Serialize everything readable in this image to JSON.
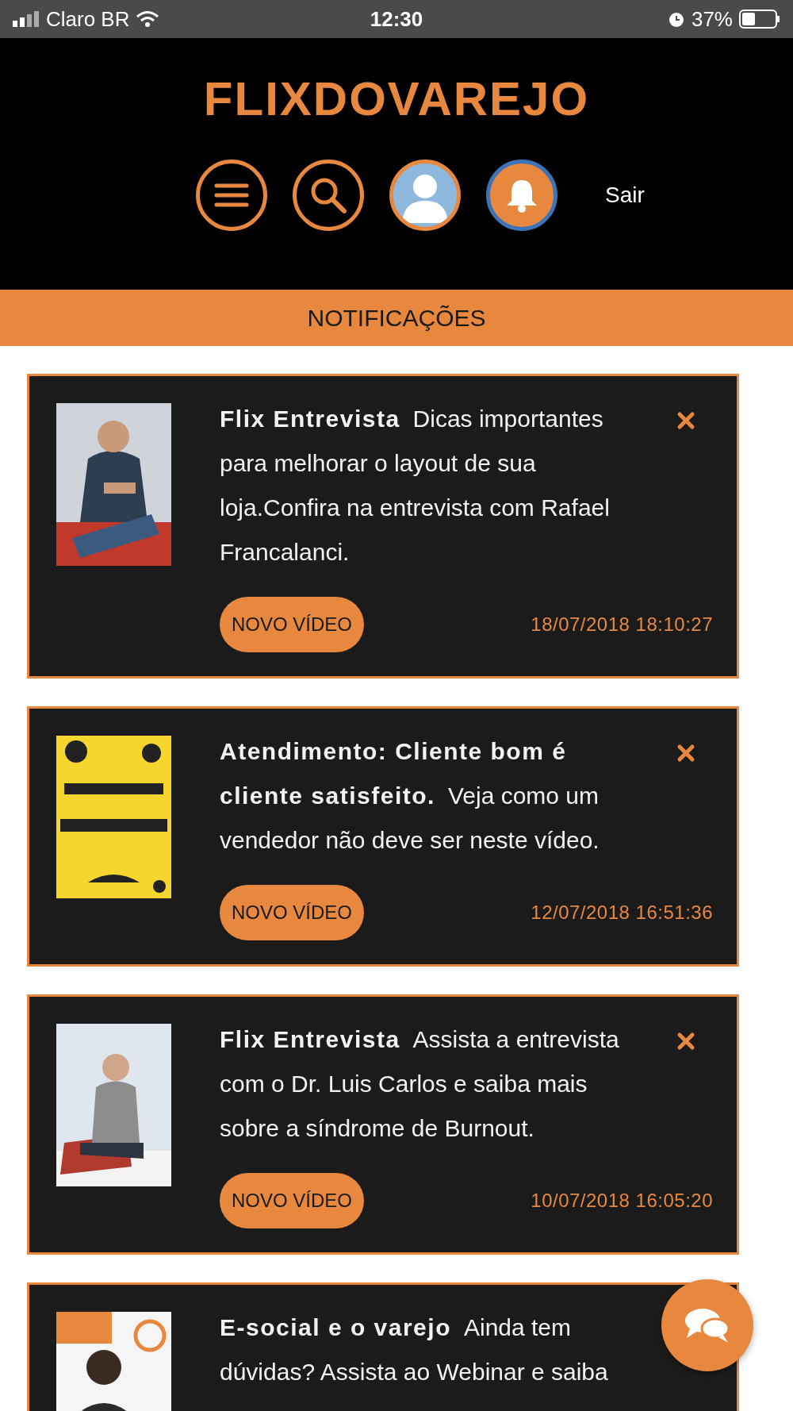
{
  "status_bar": {
    "carrier": "Claro BR",
    "time": "12:30",
    "battery": "37%"
  },
  "header": {
    "logo": "FLIXDOVAREJO",
    "logout": "Sair"
  },
  "section_title": "NOTIFICAÇÕES",
  "notifications": [
    {
      "title": "Flix Entrevista",
      "body": "Dicas importantes para melhorar o layout de sua loja.Confira na entrevista com Rafael Francalanci.",
      "tag": "NOVO VÍDEO",
      "date": "18/07/2018 18:10:27"
    },
    {
      "title": "Atendimento: Cliente bom é cliente satisfeito.",
      "body": "Veja como um vendedor não deve ser neste vídeo.",
      "tag": "NOVO VÍDEO",
      "date": "12/07/2018 16:51:36"
    },
    {
      "title": "Flix Entrevista",
      "body": "Assista a entrevista com o Dr. Luis Carlos e saiba mais sobre a síndrome de Burnout.",
      "tag": "NOVO VÍDEO",
      "date": "10/07/2018 16:05:20"
    },
    {
      "title": "E-social e o varejo",
      "body": "Ainda tem dúvidas? Assista ao Webinar e saiba"
    }
  ]
}
